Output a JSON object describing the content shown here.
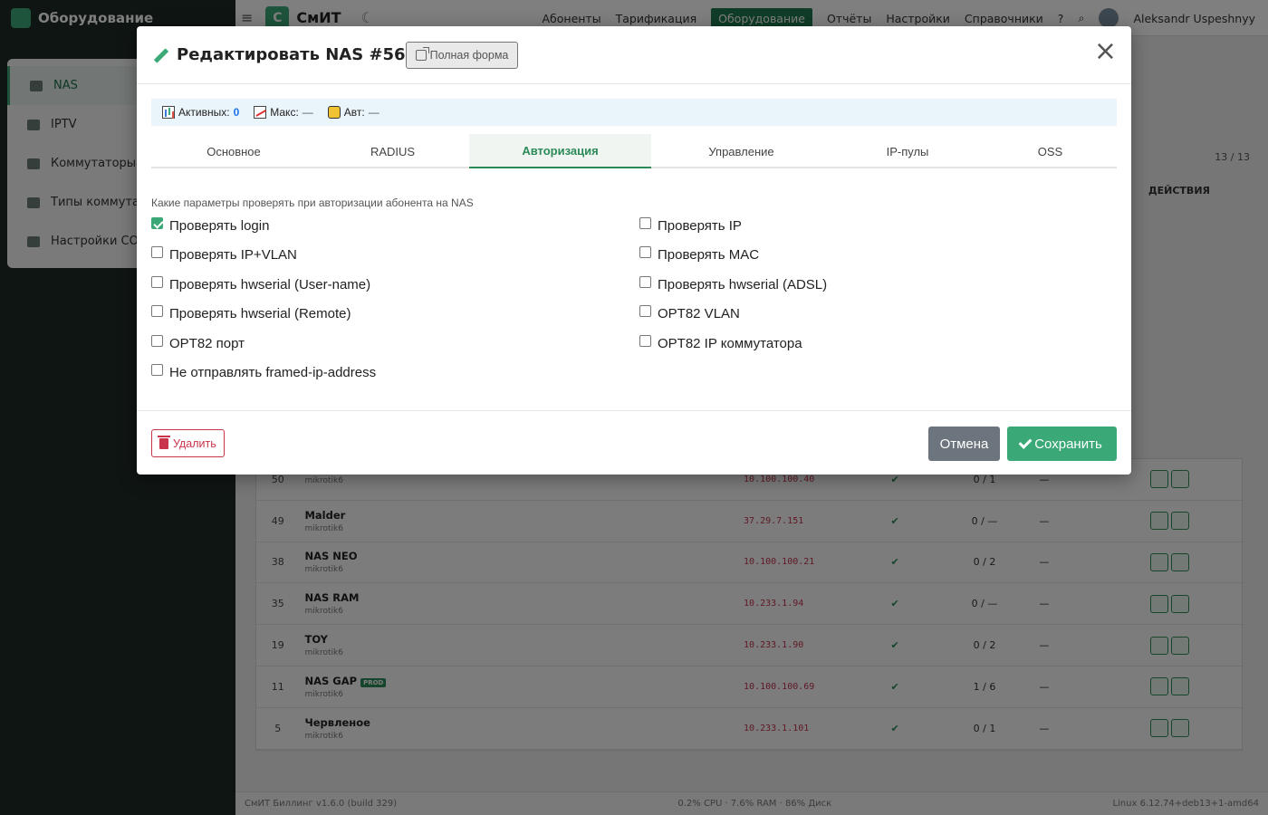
{
  "sidebar": {
    "section_title": "Оборудование",
    "items": [
      {
        "label": "NAS"
      },
      {
        "label": "IPTV"
      },
      {
        "label": "Коммутаторы"
      },
      {
        "label": "Типы коммутат"
      },
      {
        "label": "Настройки СОР"
      }
    ]
  },
  "topbar": {
    "brand": "СмИТ",
    "brand_letter": "С",
    "nav": [
      "Абоненты",
      "Тарификация",
      "Оборудование",
      "Отчёты",
      "Настройки",
      "Справочники"
    ],
    "user": "Aleksandr Uspeshnyy"
  },
  "background": {
    "count": "13 / 13",
    "actions_header": "ДЕЙСТВИЯ",
    "rows": [
      {
        "id": "50",
        "name": "",
        "type": "mikrotik6",
        "ip": "10.100.100.40",
        "sessions": "0 / 1",
        "desc": "—"
      },
      {
        "id": "49",
        "name": "Malder",
        "type": "mikrotik6",
        "ip": "37.29.7.151",
        "sessions": "0 / —",
        "desc": "—"
      },
      {
        "id": "38",
        "name": "NAS NEO",
        "type": "mikrotik6",
        "ip": "10.100.100.21",
        "sessions": "0 / 2",
        "desc": "—"
      },
      {
        "id": "35",
        "name": "NAS RAM",
        "type": "mikrotik6",
        "ip": "10.233.1.94",
        "sessions": "0 / —",
        "desc": "—"
      },
      {
        "id": "19",
        "name": "TOY",
        "type": "mikrotik6",
        "ip": "10.233.1.90",
        "sessions": "0 / 2",
        "desc": "—"
      },
      {
        "id": "11",
        "name": "NAS GAP",
        "type": "mikrotik6",
        "ip": "10.100.100.69",
        "sessions": "1 / 6",
        "desc": "—",
        "badge": "PROD"
      },
      {
        "id": "5",
        "name": "Червленое",
        "type": "mikrotik6",
        "ip": "10.233.1.101",
        "sessions": "0 / 1",
        "desc": "—"
      }
    ]
  },
  "footer": {
    "left": "СмИТ Биллинг v1.6.0 (build 329)",
    "center": "0.2% CPU · 7.6% RAM · 86% Диск",
    "right": "Linux 6.12.74+deb13+1-amd64"
  },
  "modal": {
    "title": "Редактировать NAS #56",
    "full_form": "Полная форма",
    "close": "×",
    "stats": {
      "active_label": "Активных:",
      "active_value": "0",
      "max_label": "Макс:",
      "max_value": "—",
      "auth_label": "Авт:",
      "auth_value": "—"
    },
    "tabs": [
      "Основное",
      "RADIUS",
      "Авторизация",
      "Управление",
      "IP-пулы",
      "OSS"
    ],
    "active_tab": "Авторизация",
    "hint": "Какие параметры проверять при авторизации абонента на NAS",
    "checks_left": [
      {
        "label": "Проверять login",
        "checked": true
      },
      {
        "label": "Проверять IP+VLAN",
        "checked": false
      },
      {
        "label": "Проверять hwserial (User-name)",
        "checked": false
      },
      {
        "label": "Проверять hwserial (Remote)",
        "checked": false
      },
      {
        "label": "OPT82 порт",
        "checked": false
      },
      {
        "label": "Не отправлять framed-ip-address",
        "checked": false
      }
    ],
    "checks_right": [
      {
        "label": "Проверять IP",
        "checked": false
      },
      {
        "label": "Проверять MAC",
        "checked": false
      },
      {
        "label": "Проверять hwserial (ADSL)",
        "checked": false
      },
      {
        "label": "OPT82 VLAN",
        "checked": false
      },
      {
        "label": "OPT82 IP коммутатора",
        "checked": false
      }
    ],
    "delete_label": "Удалить",
    "cancel_label": "Отмена",
    "save_label": "Сохранить"
  },
  "colors": {
    "accent": "#3aa877",
    "danger": "#c9344a",
    "secondary": "#6c757d",
    "info_bg": "#eaf4fb"
  }
}
